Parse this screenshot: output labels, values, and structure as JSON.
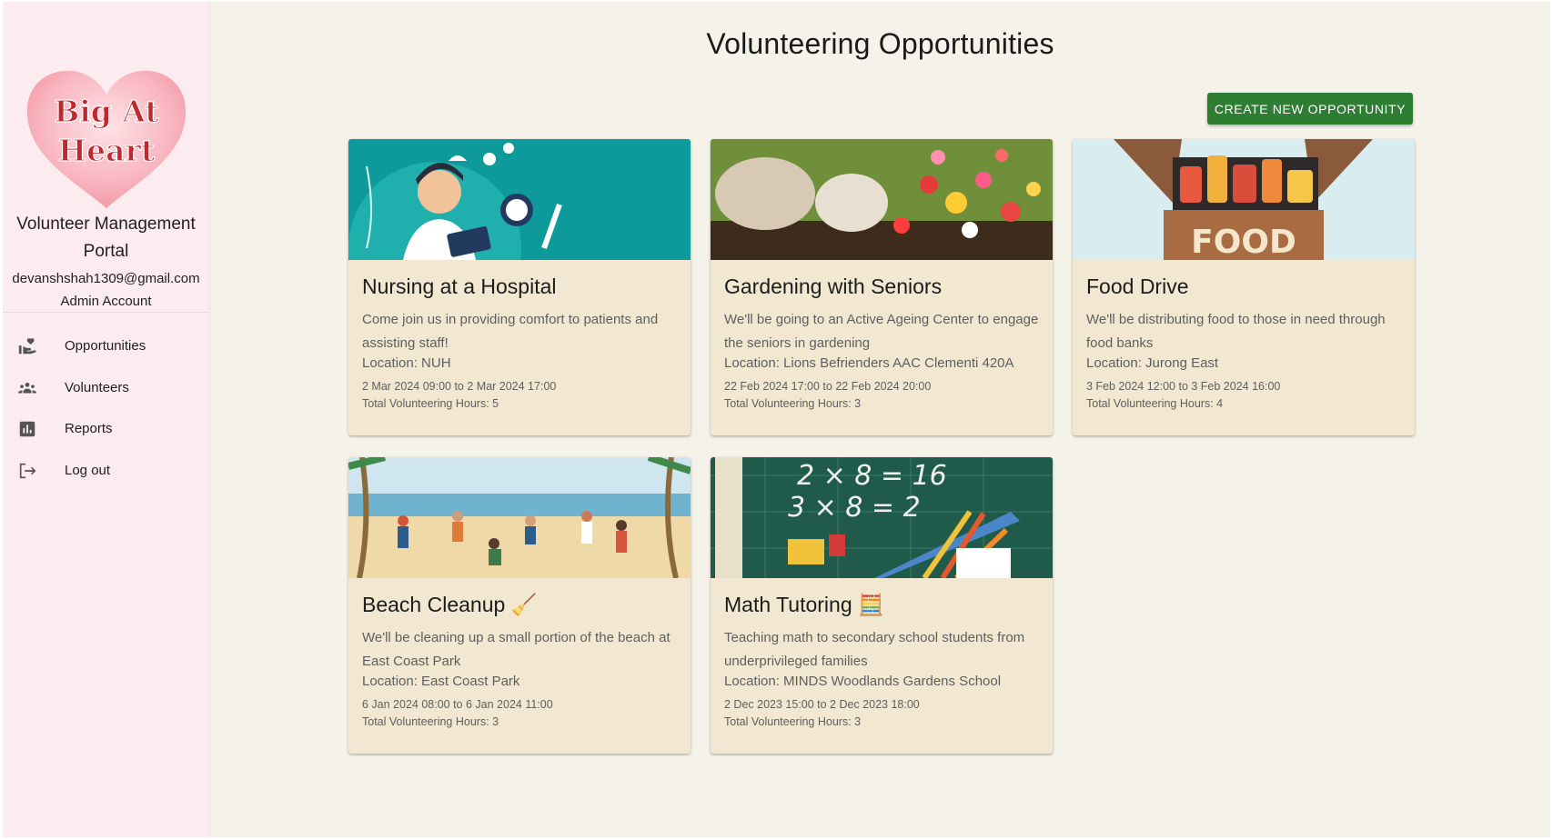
{
  "sidebar": {
    "logo_line1": "Big At",
    "logo_line2": "Heart",
    "portal_title_line1": "Volunteer Management",
    "portal_title_line2": "Portal",
    "email": "devanshshah1309@gmail.com",
    "role": "Admin Account",
    "nav": [
      {
        "label": "Opportunities",
        "icon": "volunteer-hand-heart-icon"
      },
      {
        "label": "Volunteers",
        "icon": "group-people-icon"
      },
      {
        "label": "Reports",
        "icon": "bar-chart-icon"
      },
      {
        "label": "Log out",
        "icon": "logout-icon"
      }
    ]
  },
  "main": {
    "title": "Volunteering Opportunities",
    "create_button": "CREATE NEW OPPORTUNITY",
    "cards": [
      {
        "title": "Nursing at a Hospital",
        "description": "Come join us in providing comfort to patients and assisting staff!",
        "location": "Location: NUH",
        "time": "2 Mar 2024 09:00 to 2 Mar 2024 17:00",
        "hours": "Total Volunteering Hours: 5",
        "image": "nurse-illustration"
      },
      {
        "title": "Gardening with Seniors",
        "description": "We'll be going to an Active Ageing Center to engage the seniors in gardening",
        "location": "Location: Lions Befrienders AAC Clementi 420A",
        "time": "22 Feb 2024 17:00 to 22 Feb 2024 20:00",
        "hours": "Total Volunteering Hours: 3",
        "image": "gardening-flowers-photo"
      },
      {
        "title": "Food Drive",
        "description": "We'll be distributing food to those in need through food banks",
        "location": "Location: Jurong East",
        "time": "3 Feb 2024 12:00 to 3 Feb 2024 16:00",
        "hours": "Total Volunteering Hours: 4",
        "image": "food-box-illustration",
        "image_text": "FOOD"
      },
      {
        "title": "Beach Cleanup 🧹",
        "description": "We'll be cleaning up a small portion of the beach at East Coast Park",
        "location": "Location: East Coast Park",
        "time": "6 Jan 2024 08:00 to 6 Jan 2024 11:00",
        "hours": "Total Volunteering Hours: 3",
        "image": "beach-cleanup-illustration"
      },
      {
        "title": "Math Tutoring 🧮",
        "description": "Teaching math to secondary school students from underprivileged families",
        "location": "Location: MINDS Woodlands Gardens School",
        "time": "2 Dec 2023 15:00 to 2 Dec 2023 18:00",
        "hours": "Total Volunteering Hours: 3",
        "image": "math-chalkboard-photo",
        "image_text": [
          "2 × 8 = 16",
          "3 × 8 = 2"
        ]
      }
    ]
  },
  "colors": {
    "sidebar_bg": "#fcebef",
    "main_bg": "#f5f2ea",
    "card_bg": "#f2e8d2",
    "button_green": "#2e7d32",
    "logo_heart": "#f7b6c0",
    "logo_text": "#c0282e"
  }
}
